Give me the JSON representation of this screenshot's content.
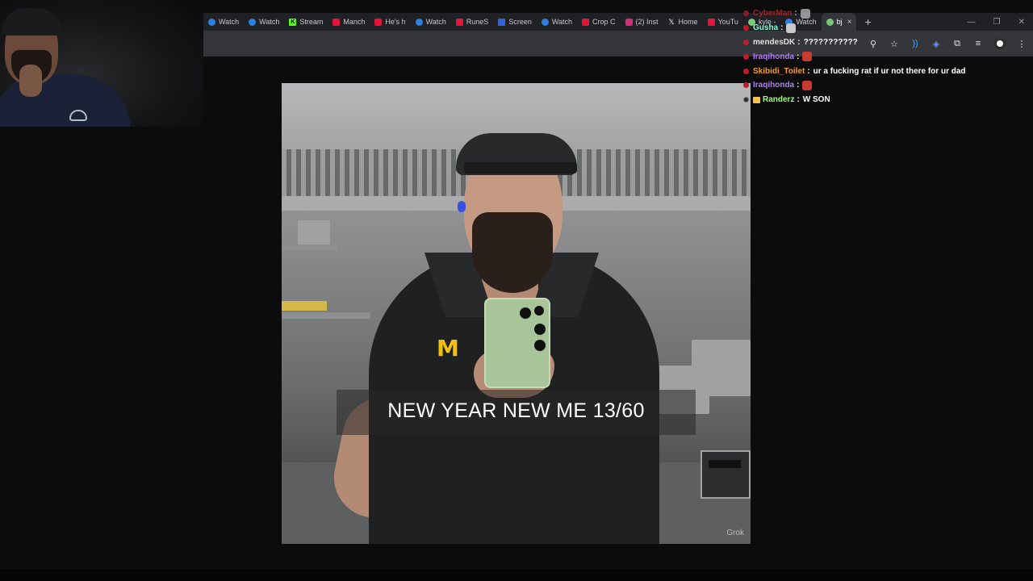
{
  "browser": {
    "tabs": [
      {
        "label": "Watch",
        "icon": "watch-tab-icon",
        "fav": "blue"
      },
      {
        "label": "Watch",
        "icon": "watch-tab-icon",
        "fav": "blue"
      },
      {
        "label": "Stream",
        "icon": "kick-icon",
        "fav": "green"
      },
      {
        "label": "Manch",
        "icon": "youtube-icon",
        "fav": "red"
      },
      {
        "label": "He's h",
        "icon": "youtube-icon",
        "fav": "red"
      },
      {
        "label": "Watch",
        "icon": "watch-tab-icon",
        "fav": "blue"
      },
      {
        "label": "RuneS",
        "icon": "youtube-icon",
        "fav": "red"
      },
      {
        "label": "Screen",
        "icon": "screen-tab-icon",
        "fav": "dkblue"
      },
      {
        "label": "Watch",
        "icon": "watch-tab-icon",
        "fav": "blue"
      },
      {
        "label": "Crop C",
        "icon": "youtube-icon",
        "fav": "red"
      },
      {
        "label": "(2) Inst",
        "icon": "instagram-icon",
        "fav": "insta"
      },
      {
        "label": "Home",
        "icon": "x-logo-icon",
        "fav": "xlogo"
      },
      {
        "label": "YouTu",
        "icon": "youtube-icon",
        "fav": "red"
      },
      {
        "label": "kyle -",
        "icon": "kyle-tab-icon",
        "fav": "ghost"
      },
      {
        "label": "Watch",
        "icon": "watch-tab-icon",
        "fav": "blue"
      }
    ],
    "active_tab": {
      "label": "bj"
    },
    "new_tab_glyph": "+",
    "close_glyph": "×"
  },
  "chat": {
    "messages": [
      {
        "user": "CyberMan",
        "color": "#c9323a",
        "text": "",
        "emote": "grey",
        "faded": true,
        "dot": "red"
      },
      {
        "user": "Gusha",
        "color": "#7fffd4",
        "text": "",
        "emote": "grey",
        "faded": false,
        "dot": "red"
      },
      {
        "user": "mendesDK",
        "color": "#e0e0e0",
        "text": "???????????",
        "emote": "",
        "faded": false,
        "dot": "red"
      },
      {
        "user": "Iraqihonda",
        "color": "#b57cf7",
        "text": "",
        "emote": "red",
        "faded": false,
        "dot": "red"
      },
      {
        "user": "Skibidi_Toilet",
        "color": "#f59b2c",
        "text": "ur a fucking rat if ur not there for ur dad",
        "emote": "",
        "faded": false,
        "dot": "red"
      },
      {
        "user": "Iraqihonda",
        "color": "#b57cf7",
        "text": "",
        "emote": "red",
        "faded": false,
        "dot": "red"
      },
      {
        "user": "Randerz",
        "color": "#9cff7a",
        "text": "W SON",
        "emote": "",
        "faded": false,
        "dot": "dark",
        "badge": true
      }
    ],
    "separator": ":"
  },
  "video": {
    "caption": "NEW YEAR NEW ME 13/60",
    "watermark": "Grok",
    "logo_letter": "M"
  },
  "colors": {
    "chat_dot": "#c11a2a",
    "mcd_logo": "#f3c011",
    "tab_bg": "#202124",
    "toolbar_bg": "#35363a"
  }
}
